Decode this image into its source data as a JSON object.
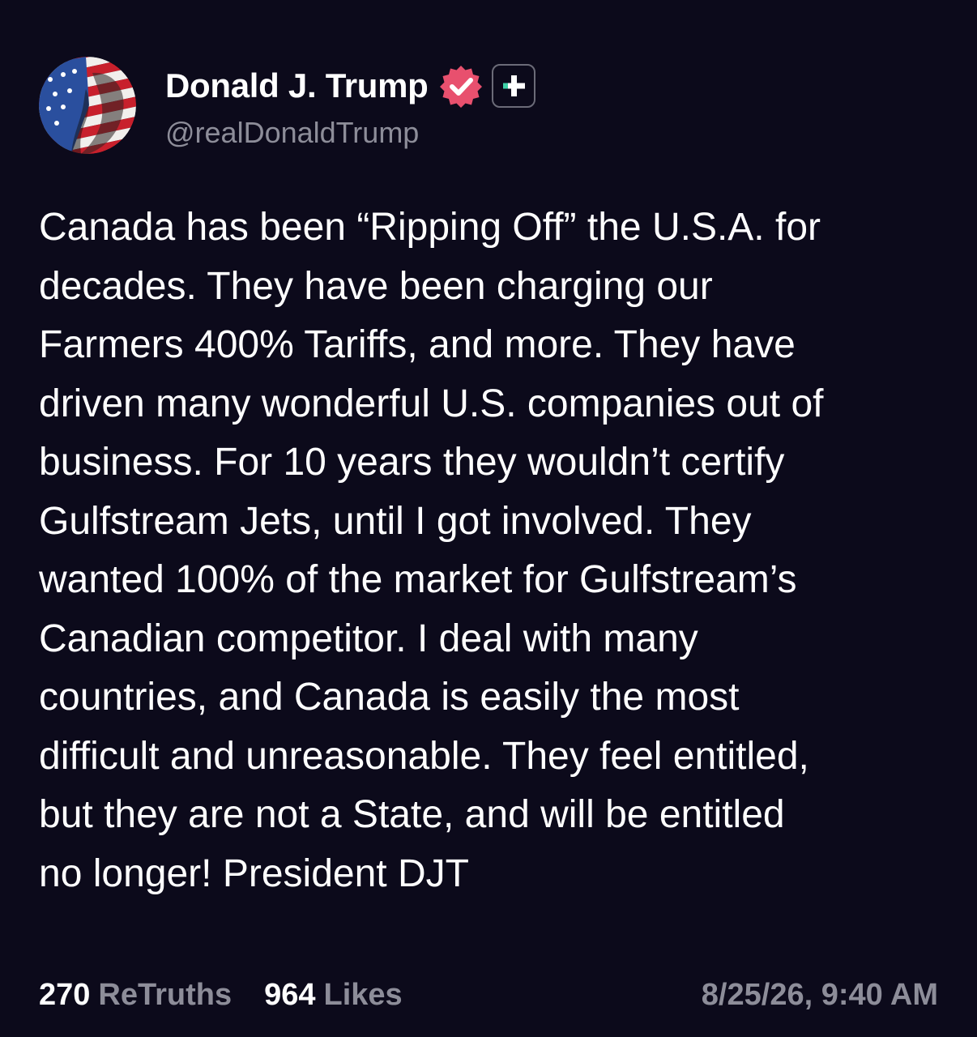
{
  "author": {
    "display_name": "Donald J. Trump",
    "handle": "@realDonaldTrump",
    "verified_badge_icon": "verified-checkmark-icon",
    "badge_color": "#e8506e",
    "plus_icon": "plus-icon",
    "plus_color": "#3fd1a8"
  },
  "post": {
    "lines": [
      "Canada has been “Ripping Off” the U.S.A. for",
      "decades. They have been charging our",
      "Farmers 400% Tariffs, and more. They have",
      "driven many wonderful U.S. companies out of",
      "business. For 10 years they wouldn’t certify",
      "Gulfstream Jets, until I got involved. They",
      "wanted 100% of the market for Gulfstream’s",
      "Canadian competitor. I deal with many",
      "countries, and Canada is easily the most",
      "difficult and unreasonable. They feel entitled,",
      "but they are not a State, and will be entitled",
      "no longer! President DJT"
    ]
  },
  "stats": {
    "retruths_count": "270",
    "retruths_label": "ReTruths",
    "likes_count": "964",
    "likes_label": "Likes"
  },
  "timestamp": "8/25/26, 9:40 AM",
  "colors": {
    "background": "#0c0a1b",
    "text": "#ffffff",
    "muted": "#8d8d99"
  }
}
